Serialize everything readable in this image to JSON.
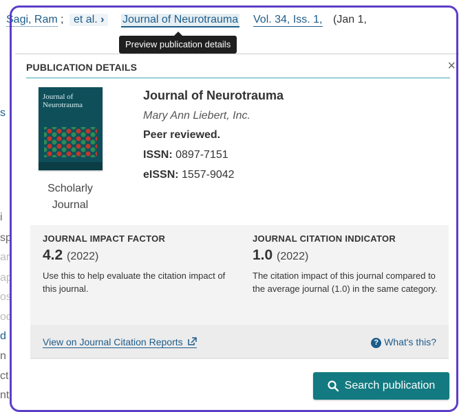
{
  "citation": {
    "author": "Sagi, Ram",
    "separator": ";",
    "et_al": "et al.",
    "et_al_chevron": "›",
    "journal": "Journal of Neurotrauma",
    "volume": "Vol. 34, Iss. 1,",
    "date": "(Jan 1,"
  },
  "tooltip": {
    "text": "Preview publication details"
  },
  "background_fragments": [
    "s",
    "i",
    "sp",
    "ar",
    "ap",
    "os",
    "od",
    "d",
    "n",
    "ct",
    "nt"
  ],
  "panel": {
    "title": "PUBLICATION DETAILS",
    "close_icon": "×",
    "cover": {
      "title_line1": "Journal of",
      "title_line2": "Neurotrauma"
    },
    "publication_type": "Scholarly Journal",
    "journal_name": "Journal of Neurotrauma",
    "publisher": "Mary Ann Liebert, Inc.",
    "peer_reviewed": "Peer reviewed.",
    "issn_label": "ISSN:",
    "issn_value": "0897-7151",
    "eissn_label": "eISSN:",
    "eissn_value": "1557-9042"
  },
  "metrics": {
    "impact": {
      "title": "JOURNAL IMPACT FACTOR",
      "value": "4.2",
      "year": "(2022)",
      "description": "Use this to help evaluate the citation impact of this journal."
    },
    "citation": {
      "title": "JOURNAL CITATION INDICATOR",
      "value": "1.0",
      "year": "(2022)",
      "description": "The citation impact of this journal compared to the average journal (1.0) in the same category."
    },
    "jcr_link": "View on Journal Citation Reports",
    "whats_this": "What's this?"
  },
  "search_button": "Search publication",
  "colors": {
    "accent": "#127a80",
    "link": "#1d5c8a",
    "focus_ring": "#5b3ec8"
  }
}
